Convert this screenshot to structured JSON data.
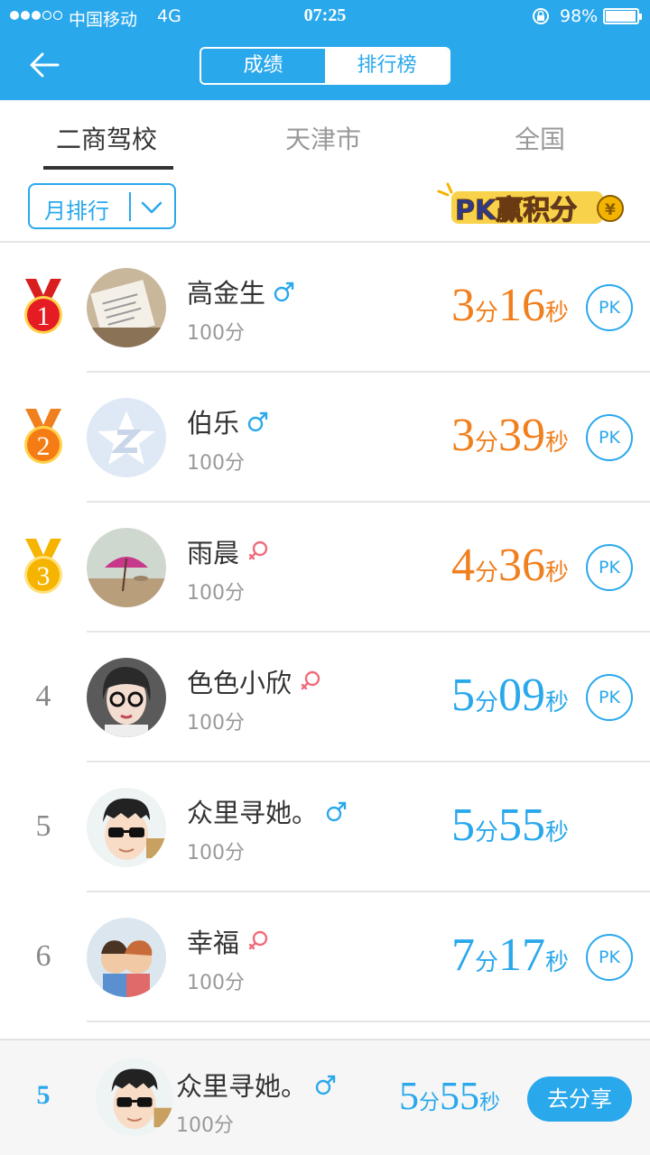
{
  "status_bar": {
    "carrier": "中国移动",
    "network": "4G",
    "time": "07:25",
    "battery": "98%"
  },
  "header": {
    "segments": [
      "成绩",
      "排行榜"
    ],
    "active_segment": "成绩"
  },
  "tabs": [
    {
      "label": "二商驾校",
      "active": true
    },
    {
      "label": "天津市",
      "active": false
    },
    {
      "label": "全国",
      "active": false
    }
  ],
  "filter": {
    "period_label": "月排行"
  },
  "banner": {
    "pk_text": "PK赢积分",
    "coin": "¥"
  },
  "time_units": {
    "min": "分",
    "sec": "秒"
  },
  "pk_label": "PK",
  "rows": [
    {
      "rank": "1",
      "name": "高金生",
      "gender": "male",
      "score": "100分",
      "min": "3",
      "sec": "16",
      "color": "#f07f1e",
      "medal": "gold-red",
      "pk": true
    },
    {
      "rank": "2",
      "name": "伯乐",
      "gender": "male",
      "score": "100分",
      "min": "3",
      "sec": "39",
      "color": "#f07f1e",
      "medal": "orange",
      "pk": true
    },
    {
      "rank": "3",
      "name": "雨晨",
      "gender": "female",
      "score": "100分",
      "min": "4",
      "sec": "36",
      "color": "#f07f1e",
      "medal": "yellow",
      "pk": true
    },
    {
      "rank": "4",
      "name": "色色小欣",
      "gender": "female",
      "score": "100分",
      "min": "5",
      "sec": "09",
      "color": "#2aa8ec",
      "medal": null,
      "pk": true
    },
    {
      "rank": "5",
      "name": "众里寻她。",
      "gender": "male",
      "score": "100分",
      "min": "5",
      "sec": "55",
      "color": "#2aa8ec",
      "medal": null,
      "pk": false
    },
    {
      "rank": "6",
      "name": "幸福",
      "gender": "female",
      "score": "100分",
      "min": "7",
      "sec": "17",
      "color": "#2aa8ec",
      "medal": null,
      "pk": true
    }
  ],
  "my_rank": {
    "rank": "5",
    "name": "众里寻她。",
    "gender": "male",
    "score": "100分",
    "min": "5",
    "sec": "55",
    "share_label": "去分享"
  },
  "colors": {
    "accent": "#2aa8ec",
    "top_time": "#f07f1e",
    "male": "#2aa8ec",
    "female": "#f06a7a"
  }
}
